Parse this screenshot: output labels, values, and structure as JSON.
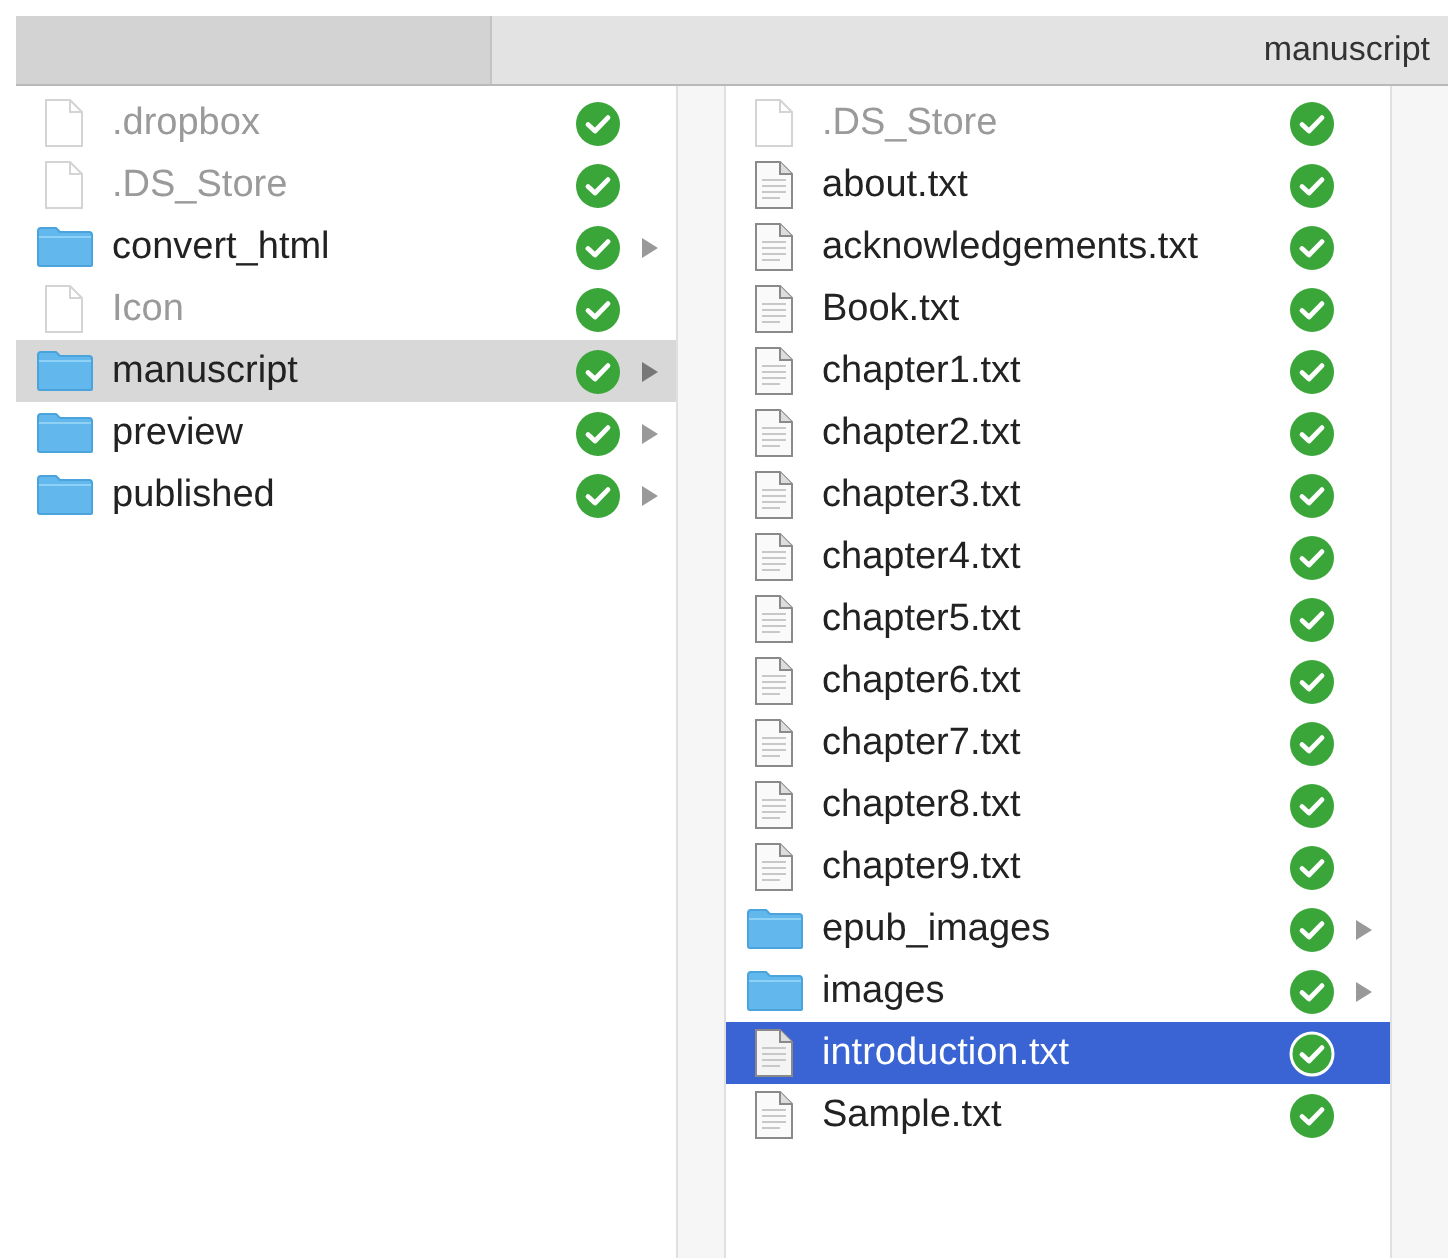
{
  "header": {
    "title": "manuscript"
  },
  "columns": [
    {
      "focused": false,
      "items": [
        {
          "name": ".dropbox",
          "kind": "hidden",
          "synced": true,
          "selected": false
        },
        {
          "name": ".DS_Store",
          "kind": "hidden",
          "synced": true,
          "selected": false
        },
        {
          "name": "convert_html",
          "kind": "folder",
          "synced": true,
          "selected": false
        },
        {
          "name": "Icon",
          "kind": "hidden",
          "synced": true,
          "selected": false
        },
        {
          "name": "manuscript",
          "kind": "folder",
          "synced": true,
          "selected": true
        },
        {
          "name": "preview",
          "kind": "folder",
          "synced": true,
          "selected": false
        },
        {
          "name": "published",
          "kind": "folder",
          "synced": true,
          "selected": false
        }
      ]
    },
    {
      "focused": true,
      "items": [
        {
          "name": ".DS_Store",
          "kind": "hidden",
          "synced": true,
          "selected": false
        },
        {
          "name": "about.txt",
          "kind": "text",
          "synced": true,
          "selected": false
        },
        {
          "name": "acknowledgements.txt",
          "kind": "text",
          "synced": true,
          "selected": false
        },
        {
          "name": "Book.txt",
          "kind": "text",
          "synced": true,
          "selected": false
        },
        {
          "name": "chapter1.txt",
          "kind": "text",
          "synced": true,
          "selected": false
        },
        {
          "name": "chapter2.txt",
          "kind": "text",
          "synced": true,
          "selected": false
        },
        {
          "name": "chapter3.txt",
          "kind": "text",
          "synced": true,
          "selected": false
        },
        {
          "name": "chapter4.txt",
          "kind": "text",
          "synced": true,
          "selected": false
        },
        {
          "name": "chapter5.txt",
          "kind": "text",
          "synced": true,
          "selected": false
        },
        {
          "name": "chapter6.txt",
          "kind": "text",
          "synced": true,
          "selected": false
        },
        {
          "name": "chapter7.txt",
          "kind": "text",
          "synced": true,
          "selected": false
        },
        {
          "name": "chapter8.txt",
          "kind": "text",
          "synced": true,
          "selected": false
        },
        {
          "name": "chapter9.txt",
          "kind": "text",
          "synced": true,
          "selected": false
        },
        {
          "name": "epub_images",
          "kind": "folder",
          "synced": true,
          "selected": false
        },
        {
          "name": "images",
          "kind": "folder",
          "synced": true,
          "selected": false
        },
        {
          "name": "introduction.txt",
          "kind": "text",
          "synced": true,
          "selected": true
        },
        {
          "name": "Sample.txt",
          "kind": "text",
          "synced": true,
          "selected": false
        }
      ]
    }
  ]
}
